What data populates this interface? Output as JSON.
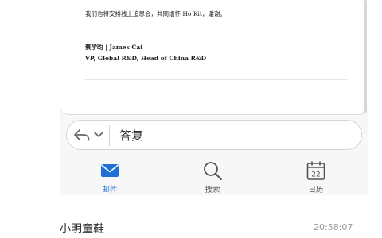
{
  "email": {
    "body_text": "我们也将安排线上追思会，共同缅怀 Ho Kit，谢谢。",
    "signature_name": "蔡学昀 | James Cai",
    "signature_title": "VP, Global R&D, Head of China R&D"
  },
  "reply_bar": {
    "reply_icon": "reply-arrow-icon",
    "dropdown_icon": "chevron-down-icon",
    "label": "答复"
  },
  "tabs": [
    {
      "label": "邮件",
      "icon": "envelope-icon",
      "active": true
    },
    {
      "label": "搜索",
      "icon": "magnifier-icon",
      "active": false
    },
    {
      "label": "日历",
      "icon": "calendar-icon",
      "active": false,
      "day": "22"
    }
  ],
  "list_item": {
    "sender": "小明童鞋",
    "time": "20:58:07"
  },
  "colors": {
    "accent": "#1f6fd6",
    "panel_bg": "#f7f7f8"
  }
}
